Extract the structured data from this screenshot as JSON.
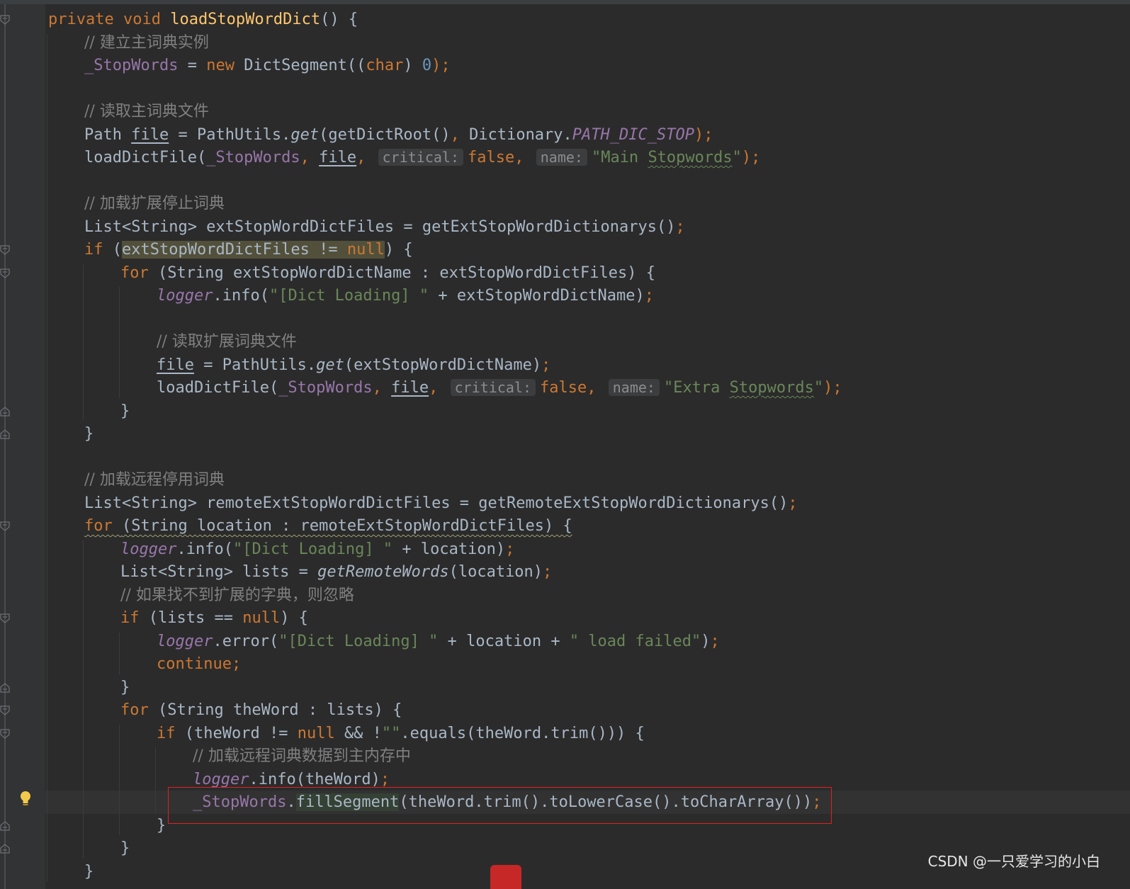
{
  "editor": {
    "lines": [
      {
        "indent": 0,
        "tokens": [
          {
            "t": "private ",
            "c": "kw"
          },
          {
            "t": "void ",
            "c": "kw"
          },
          {
            "t": "loadStopWordDict",
            "c": "fn"
          },
          {
            "t": "() {",
            "c": ""
          }
        ]
      },
      {
        "indent": 1,
        "tokens": [
          {
            "t": "// 建立主词典实例",
            "c": "comment"
          }
        ]
      },
      {
        "indent": 1,
        "tokens": [
          {
            "t": "_StopWords",
            "c": "field"
          },
          {
            "t": " = ",
            "c": ""
          },
          {
            "t": "new ",
            "c": "kw"
          },
          {
            "t": "DictSegment((",
            "c": ""
          },
          {
            "t": "char",
            "c": "kw"
          },
          {
            "t": ") ",
            "c": ""
          },
          {
            "t": "0",
            "c": "num"
          },
          {
            "t": ");",
            "c": "kw"
          }
        ]
      },
      {
        "indent": 1,
        "tokens": []
      },
      {
        "indent": 1,
        "tokens": [
          {
            "t": "// 读取主词典文件",
            "c": "comment"
          }
        ]
      },
      {
        "indent": 1,
        "tokens": [
          {
            "t": "Path ",
            "c": ""
          },
          {
            "t": "file",
            "c": "var-ul"
          },
          {
            "t": " = PathUtils.",
            "c": ""
          },
          {
            "t": "get",
            "c": "static-call"
          },
          {
            "t": "(getDictRoot()",
            "c": ""
          },
          {
            "t": ", ",
            "c": "kw"
          },
          {
            "t": "Dictionary.",
            "c": ""
          },
          {
            "t": "PATH_DIC_STOP",
            "c": "static-field"
          },
          {
            "t": ");",
            "c": "kw"
          }
        ]
      },
      {
        "indent": 1,
        "tokens": [
          {
            "t": "loadDictFile(",
            "c": ""
          },
          {
            "t": "_StopWords",
            "c": "field"
          },
          {
            "t": ", ",
            "c": "kw"
          },
          {
            "t": "file",
            "c": "var-ul"
          },
          {
            "t": ", ",
            "c": "kw"
          },
          {
            "t": "critical:",
            "c": "hint"
          },
          {
            "t": "false",
            "c": "kw"
          },
          {
            "t": ", ",
            "c": "kw"
          },
          {
            "t": "name:",
            "c": "hint"
          },
          {
            "t": "\"Main ",
            "c": "str"
          },
          {
            "t": "Stopwords",
            "c": "str typo"
          },
          {
            "t": "\"",
            "c": "str"
          },
          {
            "t": ");",
            "c": "kw"
          }
        ]
      },
      {
        "indent": 1,
        "tokens": []
      },
      {
        "indent": 1,
        "tokens": [
          {
            "t": "// 加载扩展停止词典",
            "c": "comment"
          }
        ]
      },
      {
        "indent": 1,
        "tokens": [
          {
            "t": "List<String> extStopWordDictFiles = getExtStopWordDictionarys()",
            "c": ""
          },
          {
            "t": ";",
            "c": "kw"
          }
        ]
      },
      {
        "indent": 1,
        "tokens": [
          {
            "t": "if ",
            "c": "kw"
          },
          {
            "t": "(",
            "c": ""
          },
          {
            "t": "extStopWordDictFiles != ",
            "c": "hl-cond"
          },
          {
            "t": "null",
            "c": "kw hl-cond"
          },
          {
            "t": ") {",
            "c": ""
          }
        ]
      },
      {
        "indent": 2,
        "tokens": [
          {
            "t": "for ",
            "c": "kw"
          },
          {
            "t": "(String extStopWordDictName : extStopWordDictFiles) {",
            "c": ""
          }
        ]
      },
      {
        "indent": 3,
        "tokens": [
          {
            "t": "logger",
            "c": "static-field"
          },
          {
            "t": ".info(",
            "c": ""
          },
          {
            "t": "\"[Dict Loading] \"",
            "c": "str"
          },
          {
            "t": " + extStopWordDictName)",
            "c": ""
          },
          {
            "t": ";",
            "c": "kw"
          }
        ]
      },
      {
        "indent": 3,
        "tokens": []
      },
      {
        "indent": 3,
        "tokens": [
          {
            "t": "// 读取扩展词典文件",
            "c": "comment"
          }
        ]
      },
      {
        "indent": 3,
        "tokens": [
          {
            "t": "file",
            "c": "var-ul"
          },
          {
            "t": " = PathUtils.",
            "c": ""
          },
          {
            "t": "get",
            "c": "static-call"
          },
          {
            "t": "(extStopWordDictName)",
            "c": ""
          },
          {
            "t": ";",
            "c": "kw"
          }
        ]
      },
      {
        "indent": 3,
        "tokens": [
          {
            "t": "loadDictFile(",
            "c": ""
          },
          {
            "t": "_StopWords",
            "c": "field"
          },
          {
            "t": ", ",
            "c": "kw"
          },
          {
            "t": "file",
            "c": "var-ul"
          },
          {
            "t": ", ",
            "c": "kw"
          },
          {
            "t": "critical:",
            "c": "hint"
          },
          {
            "t": "false",
            "c": "kw"
          },
          {
            "t": ", ",
            "c": "kw"
          },
          {
            "t": "name:",
            "c": "hint"
          },
          {
            "t": "\"Extra ",
            "c": "str"
          },
          {
            "t": "Stopwords",
            "c": "str typo"
          },
          {
            "t": "\"",
            "c": "str"
          },
          {
            "t": ");",
            "c": "kw"
          }
        ]
      },
      {
        "indent": 2,
        "tokens": [
          {
            "t": "}",
            "c": ""
          }
        ]
      },
      {
        "indent": 1,
        "tokens": [
          {
            "t": "}",
            "c": ""
          }
        ]
      },
      {
        "indent": 1,
        "tokens": []
      },
      {
        "indent": 1,
        "tokens": [
          {
            "t": "// 加载远程停用词典",
            "c": "comment"
          }
        ]
      },
      {
        "indent": 1,
        "tokens": [
          {
            "t": "List<String> remoteExtStopWordDictFiles = getRemoteExtStopWordDictionarys()",
            "c": ""
          },
          {
            "t": ";",
            "c": "kw"
          }
        ]
      },
      {
        "indent": 1,
        "tokens": [
          {
            "t": "for ",
            "c": "kw warn-ul"
          },
          {
            "t": "(String location : remoteExtStopWordDictFiles) {",
            "c": "warn-ul"
          }
        ]
      },
      {
        "indent": 2,
        "tokens": [
          {
            "t": "logger",
            "c": "static-field"
          },
          {
            "t": ".info(",
            "c": ""
          },
          {
            "t": "\"[Dict Loading] \"",
            "c": "str"
          },
          {
            "t": " + location)",
            "c": ""
          },
          {
            "t": ";",
            "c": "kw"
          }
        ]
      },
      {
        "indent": 2,
        "tokens": [
          {
            "t": "List<String> lists = ",
            "c": ""
          },
          {
            "t": "getRemoteWords",
            "c": "static-call"
          },
          {
            "t": "(location)",
            "c": ""
          },
          {
            "t": ";",
            "c": "kw"
          }
        ]
      },
      {
        "indent": 2,
        "tokens": [
          {
            "t": "// 如果找不到扩展的字典，则忽略",
            "c": "comment"
          }
        ]
      },
      {
        "indent": 2,
        "tokens": [
          {
            "t": "if ",
            "c": "kw"
          },
          {
            "t": "(lists == ",
            "c": ""
          },
          {
            "t": "null",
            "c": "kw"
          },
          {
            "t": ") {",
            "c": ""
          }
        ]
      },
      {
        "indent": 3,
        "tokens": [
          {
            "t": "logger",
            "c": "static-field"
          },
          {
            "t": ".error(",
            "c": ""
          },
          {
            "t": "\"[Dict Loading] \"",
            "c": "str"
          },
          {
            "t": " + location + ",
            "c": ""
          },
          {
            "t": "\" load failed\"",
            "c": "str"
          },
          {
            "t": ")",
            "c": ""
          },
          {
            "t": ";",
            "c": "kw"
          }
        ]
      },
      {
        "indent": 3,
        "tokens": [
          {
            "t": "continue;",
            "c": "kw"
          }
        ]
      },
      {
        "indent": 2,
        "tokens": [
          {
            "t": "}",
            "c": ""
          }
        ]
      },
      {
        "indent": 2,
        "tokens": [
          {
            "t": "for ",
            "c": "kw"
          },
          {
            "t": "(String theWord : lists) {",
            "c": ""
          }
        ]
      },
      {
        "indent": 3,
        "tokens": [
          {
            "t": "if ",
            "c": "kw"
          },
          {
            "t": "(theWord != ",
            "c": ""
          },
          {
            "t": "null ",
            "c": "kw"
          },
          {
            "t": "&& !",
            "c": ""
          },
          {
            "t": "\"\"",
            "c": "str"
          },
          {
            "t": ".equals(theWord.trim())) {",
            "c": ""
          }
        ]
      },
      {
        "indent": 4,
        "tokens": [
          {
            "t": "// 加载远程词典数据到主内存中",
            "c": "comment"
          }
        ]
      },
      {
        "indent": 4,
        "tokens": [
          {
            "t": "logger",
            "c": "static-field"
          },
          {
            "t": ".info(theWord)",
            "c": ""
          },
          {
            "t": ";",
            "c": "kw"
          }
        ]
      },
      {
        "indent": 4,
        "tokens": [
          {
            "t": "_StopWords",
            "c": "field"
          },
          {
            "t": ".",
            "c": ""
          },
          {
            "t": "fillSegment",
            "c": "hl-method"
          },
          {
            "t": "(theWord.trim().toLowerCase().toCharArray())",
            "c": ""
          },
          {
            "t": ";",
            "c": "kw"
          }
        ]
      },
      {
        "indent": 3,
        "tokens": [
          {
            "t": "}",
            "c": ""
          }
        ]
      },
      {
        "indent": 2,
        "tokens": [
          {
            "t": "}",
            "c": ""
          }
        ]
      },
      {
        "indent": 1,
        "tokens": [
          {
            "t": "}",
            "c": ""
          }
        ]
      }
    ],
    "current_line": 34,
    "highlighted_line": 34,
    "fold_lines": [
      0,
      10,
      11,
      17,
      18,
      22,
      26,
      29,
      30,
      31,
      35,
      36
    ],
    "intention_icon": "lightbulb-icon"
  },
  "watermark": "CSDN @一只爱学习的小白"
}
